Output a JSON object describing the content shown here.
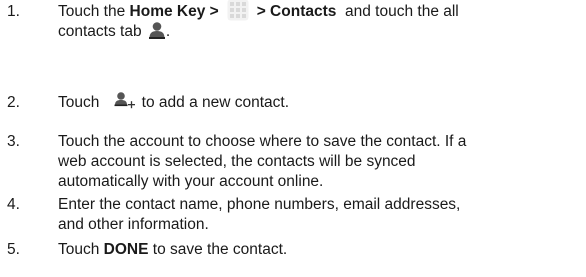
{
  "steps": [
    {
      "number": "1.",
      "line1": {
        "pre": "Touch the ",
        "bold1": "Home Key >",
        "bold2": "> Contacts",
        "post": "  and touch the all"
      },
      "line2": {
        "pre": "contacts tab "
      },
      "line2_post": "."
    },
    {
      "number": "2.",
      "pre": "Touch ",
      "post": "to add a new contact."
    },
    {
      "number": "3.",
      "lines": [
        "Touch the account to choose where to save the contact. If a",
        "web account is selected, the contacts will be synced",
        "automatically with your account online."
      ]
    },
    {
      "number": "4.",
      "lines": [
        "Enter the contact name, phone numbers, email addresses,",
        "and other information."
      ]
    },
    {
      "number": "5.",
      "pre": "Touch ",
      "bold": "DONE",
      "post": " to save the contact."
    }
  ],
  "icons": {
    "apps": "apps-grid-icon",
    "contacts_tab": "person-icon",
    "add_contact": "add-person-icon"
  }
}
